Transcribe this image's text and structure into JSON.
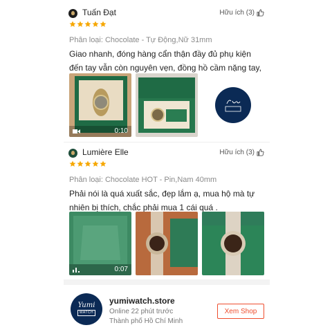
{
  "reviews": [
    {
      "name": "Tuấn Đạt",
      "helpful": "Hữu ích (3)",
      "rating": 5,
      "variant": "Phân loại: Chocolate - Tự Động,Nữ 31mm",
      "comment": "Giao nhanh, đóng hàng cẩn thận đầy đủ phụ kiện đến tay vẫn còn nguyên vẹn, đồng hồ cầm nặng tay, đẹp...",
      "video_duration": "0:10"
    },
    {
      "name": "Lumière Elle",
      "helpful": "Hữu ích (3)",
      "rating": 5,
      "variant": "Phân loại: Chocolate HOT - Pin,Nam 40mm",
      "comment": "Phải nói là quá xuất sắc, đẹp lắm ạ, mua hộ mà tự nhiên bị thích, chắc phải mua 1 cái quá .",
      "video_duration": "0:07"
    }
  ],
  "shop": {
    "name": "yumiwatch.store",
    "online": "Online 22 phút trước",
    "city": "Thành phố Hồ Chí Minh",
    "button": "Xem Shop",
    "logo_script": "Yumi",
    "logo_word": "WATCH"
  },
  "colors": {
    "accent": "#ee4d2d",
    "star": "#f6a700",
    "box_green": "#1f6b45"
  }
}
